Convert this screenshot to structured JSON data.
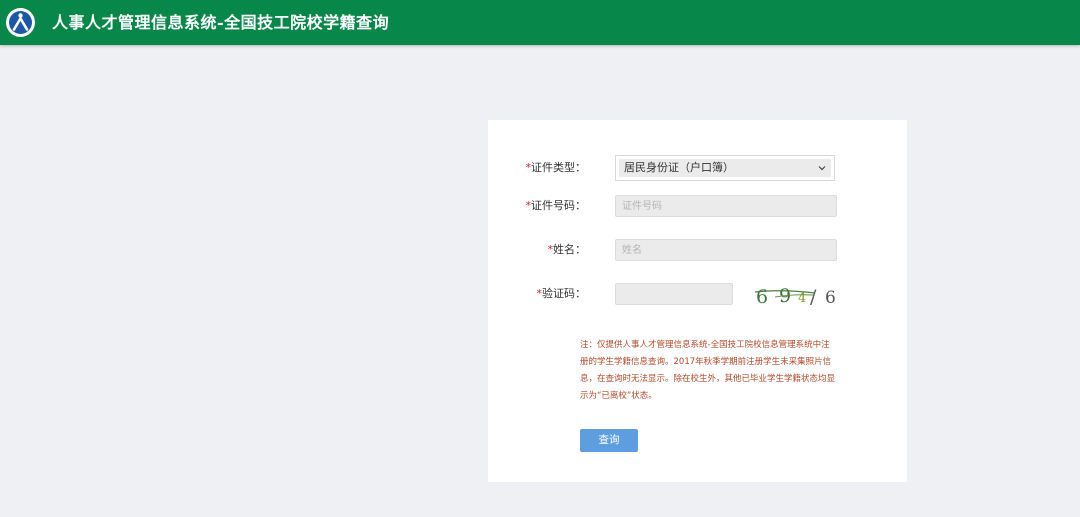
{
  "header": {
    "title": "人事人才管理信息系统-全国技工院校学籍查询",
    "bg_color": "#07884a",
    "logo_icon": "person-in-circle-logo-icon"
  },
  "form": {
    "id_type": {
      "label": "证件类型：",
      "value": "居民身份证（户口簿）",
      "icon": "chevron-down-icon"
    },
    "id_number": {
      "label": "证件号码：",
      "placeholder": "证件号码",
      "value": ""
    },
    "name": {
      "label": "姓名：",
      "placeholder": "姓名",
      "value": ""
    },
    "captcha": {
      "label": "验证码：",
      "value": "",
      "image_chars": [
        "6",
        "9",
        "4",
        "/",
        "6"
      ]
    },
    "required_mark": "*",
    "required_color": "#e02020"
  },
  "notice": {
    "text": "注：仅提供人事人才管理信息系统-全国技工院校信息管理系统中注册的学生学籍信息查询。2017年秋季学期前注册学生未采集照片信息，在查询时无法显示。除在校生外，其他已毕业学生学籍状态均显示为“已离校”状态。",
    "color": "#b5482c"
  },
  "actions": {
    "query_label": "查询",
    "button_color": "#5d9de0"
  }
}
